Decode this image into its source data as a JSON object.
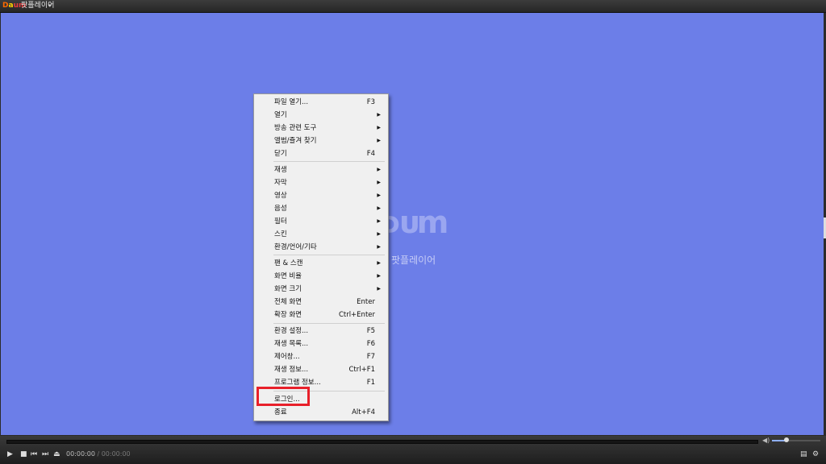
{
  "app": {
    "logo": {
      "d1": "D",
      "d2": "a",
      "d3": "um"
    },
    "title": "팟플레이어",
    "title_caret": "▾"
  },
  "watermark": {
    "logo": "ᴅᴜm",
    "text": "팟플레이어"
  },
  "menu": {
    "items": [
      {
        "label": "파일 열기...",
        "shortcut": "F3",
        "submenu": false
      },
      {
        "label": "열기",
        "shortcut": "",
        "submenu": true
      },
      {
        "label": "방송 관련 도구",
        "shortcut": "",
        "submenu": true
      },
      {
        "label": "앨범/즐겨 찾기",
        "shortcut": "",
        "submenu": true
      },
      {
        "label": "닫기",
        "shortcut": "F4",
        "submenu": false
      },
      {
        "label": "재생",
        "shortcut": "",
        "submenu": true
      },
      {
        "label": "자막",
        "shortcut": "",
        "submenu": true
      },
      {
        "label": "영상",
        "shortcut": "",
        "submenu": true
      },
      {
        "label": "음성",
        "shortcut": "",
        "submenu": true
      },
      {
        "label": "필터",
        "shortcut": "",
        "submenu": true
      },
      {
        "label": "스킨",
        "shortcut": "",
        "submenu": true
      },
      {
        "label": "환경/언어/기타",
        "shortcut": "",
        "submenu": true
      },
      {
        "label": "팬 & 스캔",
        "shortcut": "",
        "submenu": true
      },
      {
        "label": "화면 비율",
        "shortcut": "",
        "submenu": true
      },
      {
        "label": "화면 크기",
        "shortcut": "",
        "submenu": true
      },
      {
        "label": "전체 화면",
        "shortcut": "Enter",
        "submenu": false
      },
      {
        "label": "확장 화면",
        "shortcut": "Ctrl+Enter",
        "submenu": false
      },
      {
        "label": "환경 설정...",
        "shortcut": "F5",
        "submenu": false
      },
      {
        "label": "재생 목록...",
        "shortcut": "F6",
        "submenu": false
      },
      {
        "label": "제어창...",
        "shortcut": "F7",
        "submenu": false
      },
      {
        "label": "재생 정보...",
        "shortcut": "Ctrl+F1",
        "submenu": false
      },
      {
        "label": "프로그램 정보...",
        "shortcut": "F1",
        "submenu": false
      },
      {
        "label": "로그인...",
        "shortcut": "",
        "submenu": false
      },
      {
        "label": "종료",
        "shortcut": "Alt+F4",
        "submenu": false
      }
    ]
  },
  "controls": {
    "current_time": "00:00:00",
    "separator": " / ",
    "total_time": "00:00:00",
    "volume_level": 0.3
  },
  "colors": {
    "video_bg": "#6c7ee8",
    "highlight": "#e8202a",
    "menu_bg": "#f0f0f0"
  }
}
